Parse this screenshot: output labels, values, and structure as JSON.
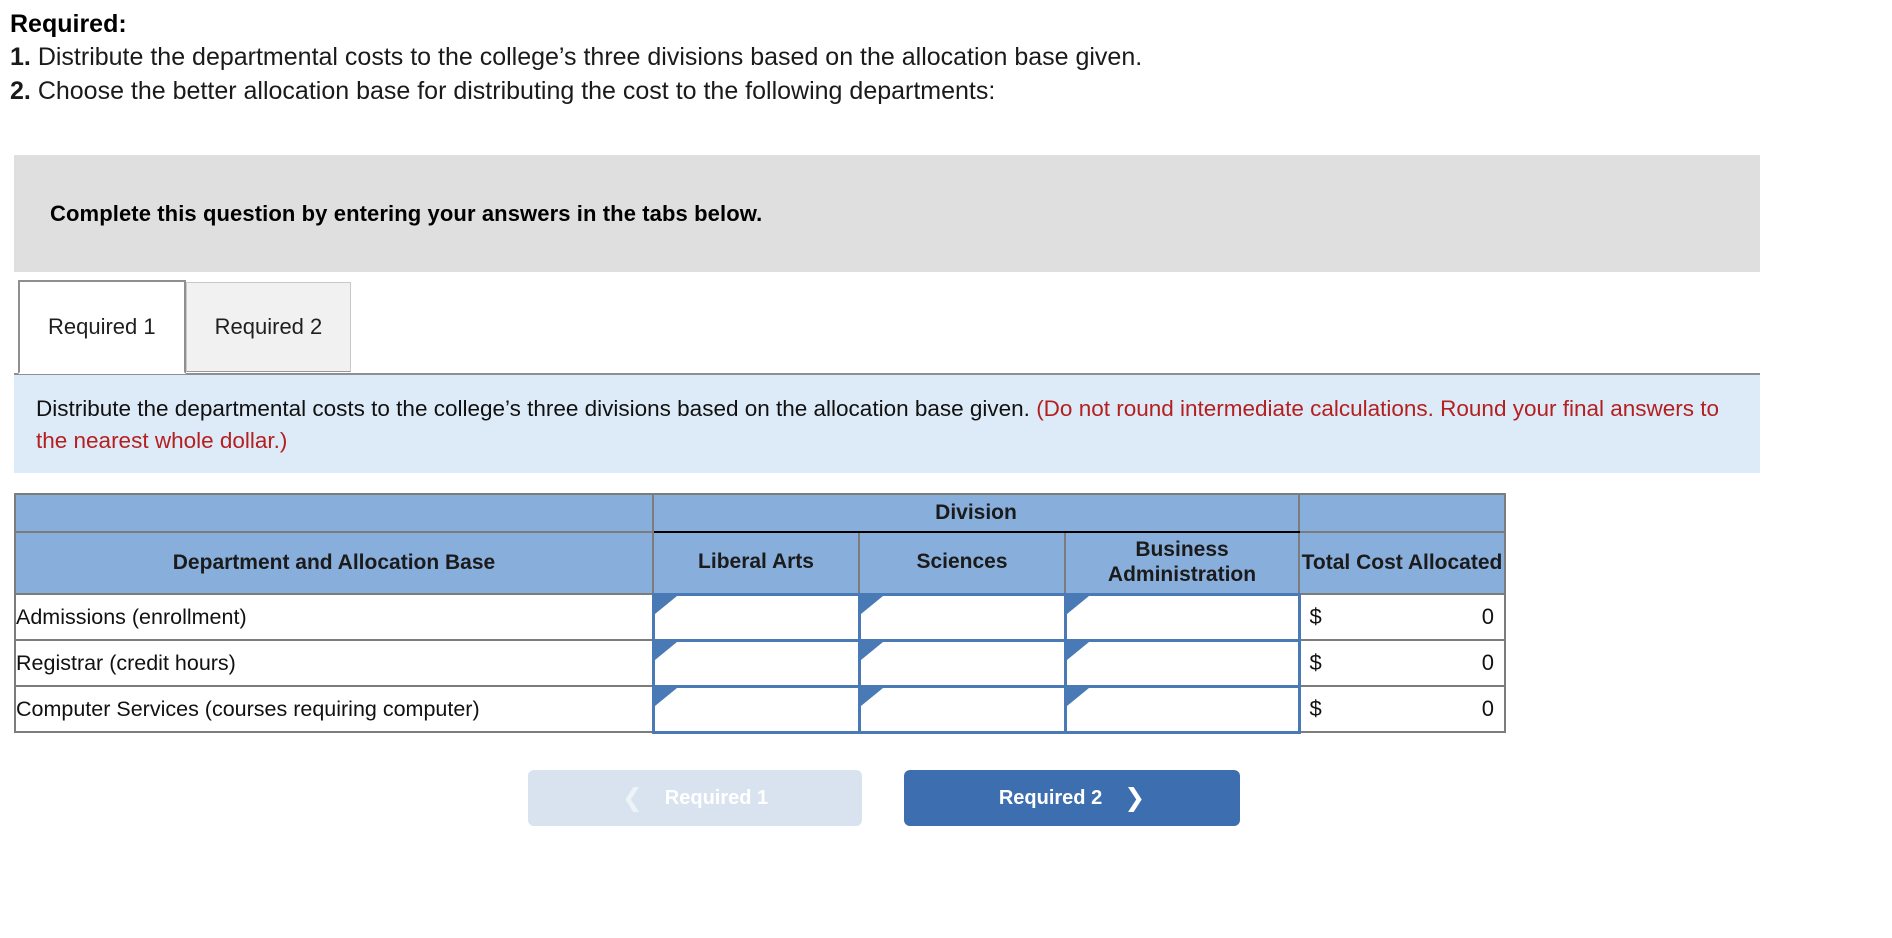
{
  "required_header": {
    "title": "Required:",
    "items": [
      {
        "num": "1.",
        "text": "Distribute the departmental costs to the college’s three divisions based on the allocation base given."
      },
      {
        "num": "2.",
        "text": "Choose the better allocation base for distributing the cost to the following departments:"
      }
    ]
  },
  "banner": {
    "text": "Complete this question by entering your answers in the tabs below."
  },
  "tabs": [
    {
      "label": "Required 1",
      "active": true
    },
    {
      "label": "Required 2",
      "active": false
    }
  ],
  "instruction_panel": {
    "black_text": "Distribute the departmental costs to the college’s three divisions based on the allocation base given. ",
    "red_text": "(Do not round intermediate calculations. Round your final answers to the nearest whole dollar.)"
  },
  "table": {
    "group_header": "Division",
    "columns": {
      "dept": "Department and Allocation Base",
      "liberal_arts": "Liberal Arts",
      "sciences": "Sciences",
      "business_admin": "Business Administration",
      "total": "Total Cost Allocated"
    },
    "rows": [
      {
        "dept": "Admissions (enrollment)",
        "liberal_arts": "",
        "sciences": "",
        "business_admin": "",
        "currency": "$",
        "total": "0"
      },
      {
        "dept": "Registrar (credit hours)",
        "liberal_arts": "",
        "sciences": "",
        "business_admin": "",
        "currency": "$",
        "total": "0"
      },
      {
        "dept": "Computer Services (courses requiring computer)",
        "liberal_arts": "",
        "sciences": "",
        "business_admin": "",
        "currency": "$",
        "total": "0"
      }
    ]
  },
  "nav": {
    "prev_label": "Required 1",
    "prev_icon": "chevron-left-icon",
    "next_label": "Required 2",
    "next_icon": "chevron-right-icon"
  },
  "colors": {
    "header_blue": "#88aedc",
    "panel_blue": "#ddeaf7",
    "banner_gray": "#dfdfdf",
    "input_border_blue": "#4a7ab5",
    "red_text": "#b42020",
    "next_button": "#3d6eb0",
    "prev_button": "#d8e3ef"
  }
}
